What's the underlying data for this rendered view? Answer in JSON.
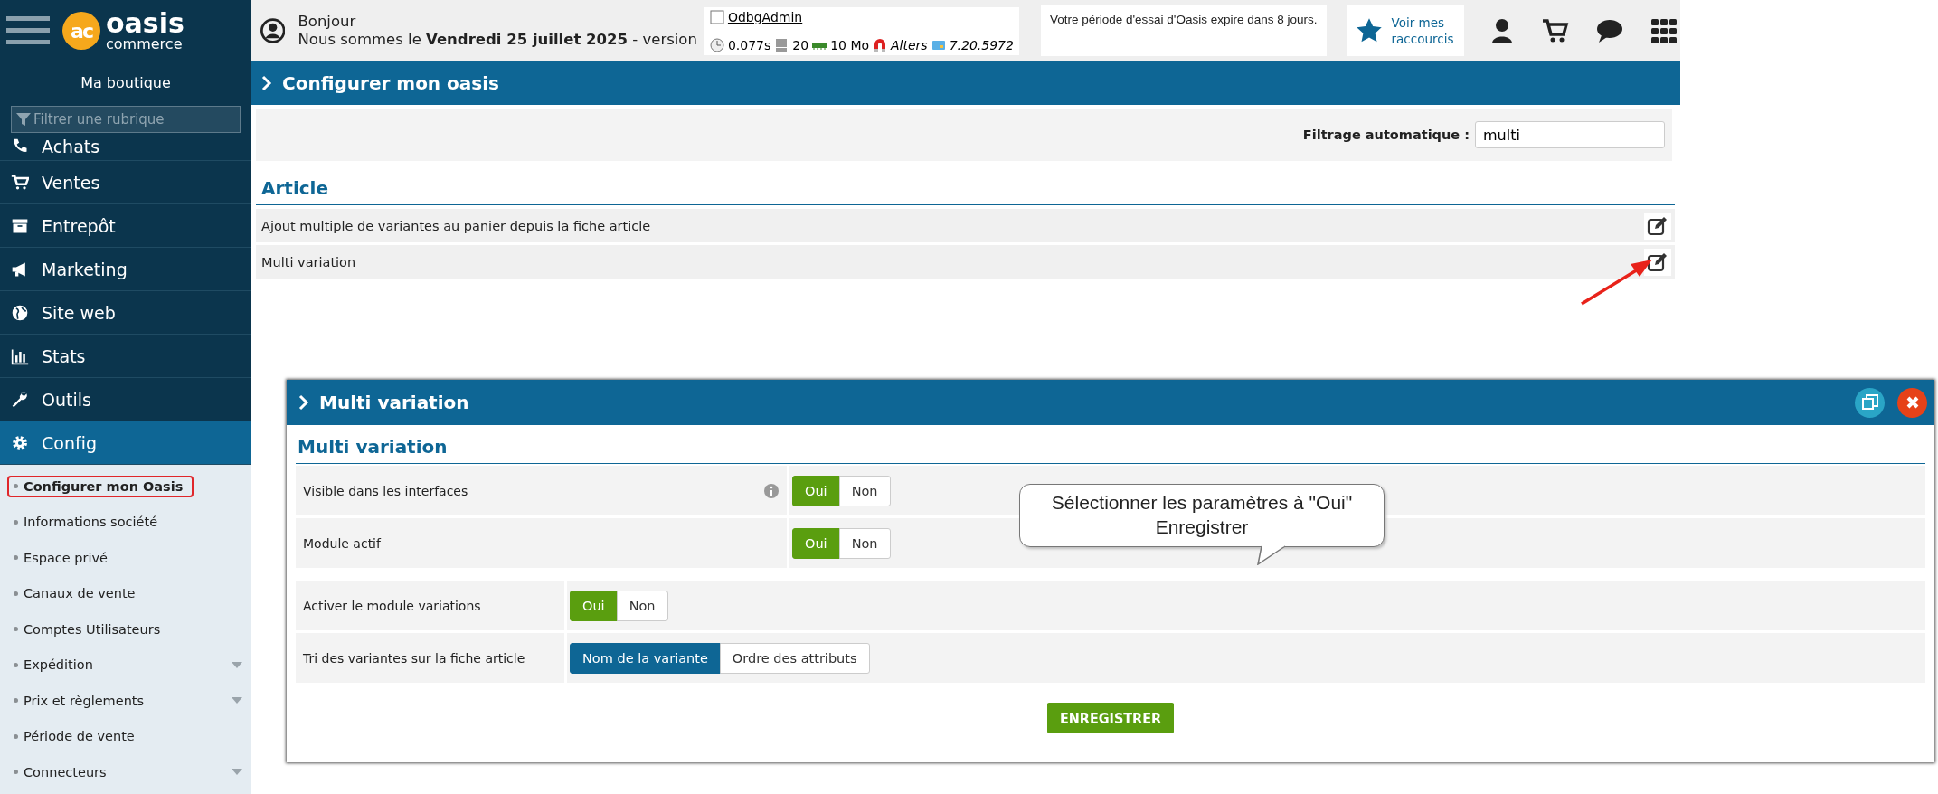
{
  "sidebar": {
    "logo": {
      "mark": "ac",
      "name": "oasis",
      "tagline": "commerce"
    },
    "store": "Ma boutique",
    "filter": {
      "placeholder": "Filtrer une rubrique"
    },
    "nav": [
      {
        "label": "Achats",
        "selected": false
      },
      {
        "label": "Ventes",
        "selected": false
      },
      {
        "label": "Entrepôt",
        "selected": false
      },
      {
        "label": "Marketing",
        "selected": false
      },
      {
        "label": "Site web",
        "selected": false
      },
      {
        "label": "Stats",
        "selected": false
      },
      {
        "label": "Outils",
        "selected": false
      },
      {
        "label": "Config",
        "selected": true
      }
    ],
    "subnav": [
      {
        "label": "Configurer mon Oasis",
        "selected": true,
        "expandable": false
      },
      {
        "label": "Informations société",
        "selected": false,
        "expandable": false
      },
      {
        "label": "Espace privé",
        "selected": false,
        "expandable": false
      },
      {
        "label": "Canaux de vente",
        "selected": false,
        "expandable": false
      },
      {
        "label": "Comptes Utilisateurs",
        "selected": false,
        "expandable": false
      },
      {
        "label": "Expédition",
        "selected": false,
        "expandable": true
      },
      {
        "label": "Prix et règlements",
        "selected": false,
        "expandable": true
      },
      {
        "label": "Période de vente",
        "selected": false,
        "expandable": false
      },
      {
        "label": "Connecteurs",
        "selected": false,
        "expandable": true
      }
    ]
  },
  "header": {
    "greeting": "Bonjour",
    "date_line": "Nous sommes le **Vendredi 25 juillet 2025** - version",
    "debug": {
      "user": "OdbgAdmin",
      "time": "0.077s",
      "queries": "20",
      "memory": "10 Mo",
      "alters": "Alters",
      "version": "7.20.5972"
    },
    "trial_notice": "Votre période d'essai d'Oasis expire dans 8 jours.",
    "shortcuts": "Voir mes raccourcis"
  },
  "page": {
    "title": "Configurer mon oasis",
    "filter": {
      "label": "Filtrage automatique :",
      "value": "multi"
    },
    "section": "Article",
    "rows": [
      {
        "label": "Ajout multiple de variantes au panier depuis la fiche article"
      },
      {
        "label": "Multi variation"
      }
    ]
  },
  "modal": {
    "title": "Multi variation",
    "section": "Multi variation",
    "groups": [
      {
        "rows": [
          {
            "label": "Visible dans les interfaces",
            "info": true,
            "kind": "toggle",
            "options": [
              {
                "label": "Oui",
                "selected": true
              },
              {
                "label": "Non",
                "selected": false
              }
            ]
          },
          {
            "label": "Module actif",
            "info": false,
            "kind": "toggle",
            "options": [
              {
                "label": "Oui",
                "selected": true
              },
              {
                "label": "Non",
                "selected": false
              }
            ]
          }
        ]
      },
      {
        "rows": [
          {
            "label": "Activer le module variations",
            "info": false,
            "kind": "toggle",
            "options": [
              {
                "label": "Oui",
                "selected": true
              },
              {
                "label": "Non",
                "selected": false
              }
            ]
          },
          {
            "label": "Tri des variantes sur la fiche article",
            "info": false,
            "kind": "choice",
            "options": [
              {
                "label": "Nom de la variante",
                "selected": true
              },
              {
                "label": "Ordre des attributs",
                "selected": false
              }
            ]
          }
        ]
      }
    ],
    "save": "ENREGISTRER",
    "callout": [
      "Sélectionner les paramètres à \"Oui\"",
      "Enregistrer"
    ]
  }
}
